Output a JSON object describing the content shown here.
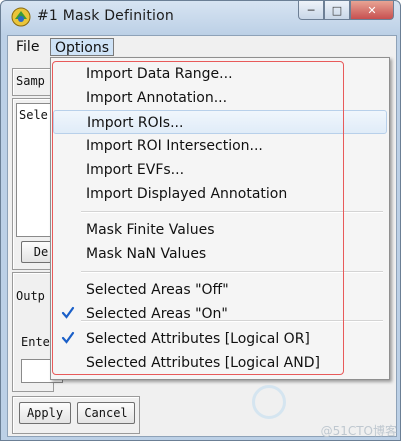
{
  "window": {
    "title": "#1 Mask Definition",
    "buttons": {
      "minimize": "─",
      "maximize": "□",
      "close": "✕"
    }
  },
  "menubar": {
    "file": "File",
    "options": "Options"
  },
  "background": {
    "samp_label": "Samp",
    "sele_label": "Sele",
    "de_button": "De",
    "outp_label": "Outp",
    "ent_label": "Ente",
    "apply_button": "Apply",
    "cancel_button": "Cancel"
  },
  "options_menu": {
    "items": [
      {
        "label": "Import Data Range...",
        "checked": false
      },
      {
        "label": "Import Annotation...",
        "checked": false
      },
      {
        "label": "Import ROIs...",
        "checked": false,
        "hovered": true
      },
      {
        "label": "Import ROI Intersection...",
        "checked": false
      },
      {
        "label": "Import EVFs...",
        "checked": false
      },
      {
        "label": "Import Displayed Annotation",
        "checked": false
      },
      {
        "label": "Mask Finite Values",
        "checked": false
      },
      {
        "label": "Mask NaN Values",
        "checked": false
      },
      {
        "label": "Selected Areas \"Off\"",
        "checked": false
      },
      {
        "label": "Selected Areas \"On\"",
        "checked": true
      },
      {
        "label": "Selected Attributes [Logical OR]",
        "checked": true
      },
      {
        "label": "Selected Attributes [Logical AND]",
        "checked": false
      }
    ]
  },
  "watermark": "@51CTO博客",
  "colors": {
    "check": "#1a5fc8",
    "highlight_box": "#e85a5a"
  }
}
